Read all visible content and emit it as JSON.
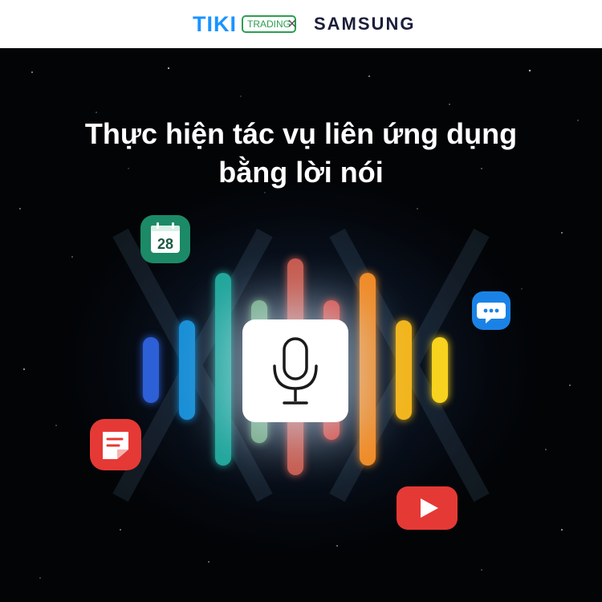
{
  "header": {
    "brand": "TIKI",
    "badge": "TRADING",
    "separator": "×",
    "partner": "SAMSUNG"
  },
  "hero": {
    "title_line1": "Thực hiện tác vụ liên ứng dụng",
    "title_line2": "bằng lời nói"
  },
  "apps": {
    "calendar_day": "28",
    "calendar_color": "#1c8a66",
    "messages_color": "#1a82e6",
    "notes_color": "#e53935",
    "youtube_color": "#e53935"
  },
  "voice_bars": [
    "#2d5fd7",
    "#1a8fd6",
    "#1fa59a",
    "#6fa47a",
    "#c65a4e",
    "#d6453a",
    "#f08a25",
    "#f2b51c",
    "#f7d21e"
  ],
  "icons": [
    "microphone-icon",
    "calendar-icon",
    "chat-icon",
    "notes-icon",
    "play-icon"
  ]
}
